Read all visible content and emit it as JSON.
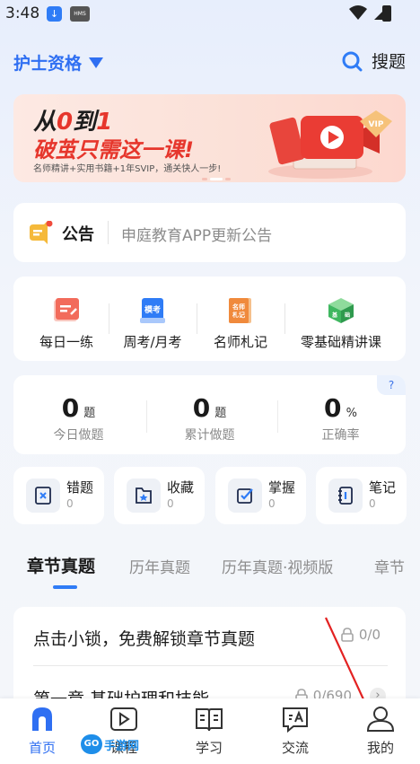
{
  "status_bar": {
    "time": "3:48"
  },
  "header": {
    "exam_name": "护士资格",
    "search_label": "搜题",
    "accent_color": "#2f6ff2"
  },
  "banner": {
    "line1_a": "从",
    "line1_b": "0",
    "line1_c": "到",
    "line1_d": "1",
    "line2": "破茧只需这一课!",
    "line3": "名师精讲+实用书籍+1年SVIP，通关快人一步!",
    "badge": "VIP"
  },
  "notice": {
    "label": "公告",
    "text": "申庭教育APP更新公告"
  },
  "quick_actions": [
    {
      "label": "每日一练",
      "icon": "daily-practice-icon",
      "color": "#f26b5b"
    },
    {
      "label": "周考/月考",
      "icon": "mock-exam-icon",
      "icon_text": "模考",
      "color": "#2f7cf6"
    },
    {
      "label": "名师札记",
      "icon": "teacher-notes-icon",
      "icon_text": "名师札记",
      "color": "#f08a3c"
    },
    {
      "label": "零基础精讲课",
      "icon": "basic-course-icon",
      "icon_text": "基础",
      "color": "#3fb760"
    }
  ],
  "stats": {
    "help": "?",
    "items": [
      {
        "value": "0",
        "unit": "题",
        "label": "今日做题"
      },
      {
        "value": "0",
        "unit": "题",
        "label": "累计做题"
      },
      {
        "value": "0",
        "unit": "%",
        "label": "正确率"
      }
    ]
  },
  "tools": [
    {
      "label": "错题",
      "count": "0",
      "icon": "wrong-questions-icon"
    },
    {
      "label": "收藏",
      "count": "0",
      "icon": "favorites-icon"
    },
    {
      "label": "掌握",
      "count": "0",
      "icon": "mastered-icon"
    },
    {
      "label": "笔记",
      "count": "0",
      "icon": "notes-icon"
    }
  ],
  "tabs": [
    {
      "label": "章节真题",
      "active": true
    },
    {
      "label": "历年真题",
      "active": false
    },
    {
      "label": "历年真题·视频版",
      "active": false
    },
    {
      "label": "章节",
      "active": false
    }
  ],
  "list": {
    "unlock_text": "点击小锁，免费解锁章节真题",
    "unlock_progress": "0/0",
    "chapter_title": "第一章 基础护理和技能",
    "chapter_progress": "0/690",
    "chevron": "›"
  },
  "bottom_nav": [
    {
      "label": "首页",
      "icon": "home-icon",
      "active": true
    },
    {
      "label": "课程",
      "icon": "course-icon",
      "active": false
    },
    {
      "label": "学习",
      "icon": "study-icon",
      "active": false
    },
    {
      "label": "交流",
      "icon": "community-icon",
      "active": false
    },
    {
      "label": "我的",
      "icon": "profile-icon",
      "active": false
    }
  ],
  "watermark": {
    "badge": "GO",
    "text": "手游网"
  }
}
